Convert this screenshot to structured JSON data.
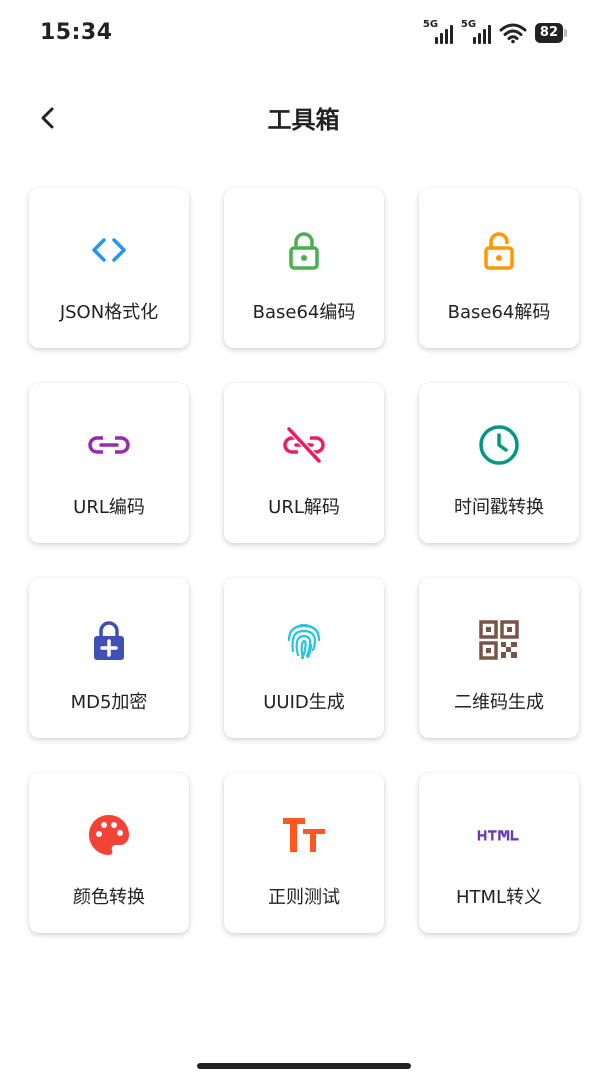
{
  "status_bar": {
    "time": "15:34",
    "signal1_label": "5G",
    "signal2_label": "5G",
    "battery": "82"
  },
  "header": {
    "back_icon": "chevron-left-icon",
    "title": "工具箱"
  },
  "tools": [
    {
      "label": "JSON格式化",
      "icon": "code-icon",
      "color": "#2196F3"
    },
    {
      "label": "Base64编码",
      "icon": "lock-closed-icon",
      "color": "#4CAF50"
    },
    {
      "label": "Base64解码",
      "icon": "lock-open-icon",
      "color": "#FF9800"
    },
    {
      "label": "URL编码",
      "icon": "link-icon",
      "color": "#9C27B0"
    },
    {
      "label": "URL解码",
      "icon": "link-off-icon",
      "color": "#E91E63"
    },
    {
      "label": "时间戳转换",
      "icon": "clock-icon",
      "color": "#009688"
    },
    {
      "label": "MD5加密",
      "icon": "enhanced-encryption-icon",
      "color": "#3F51B5"
    },
    {
      "label": "UUID生成",
      "icon": "fingerprint-icon",
      "color": "#26C6DA"
    },
    {
      "label": "二维码生成",
      "icon": "qr-code-icon",
      "color": "#795548"
    },
    {
      "label": "颜色转换",
      "icon": "palette-icon",
      "color": "#F44336"
    },
    {
      "label": "正则测试",
      "icon": "text-fields-icon",
      "color": "#FF5722"
    },
    {
      "label": "HTML转义",
      "icon": "html-icon",
      "color": "#673AB7"
    }
  ]
}
